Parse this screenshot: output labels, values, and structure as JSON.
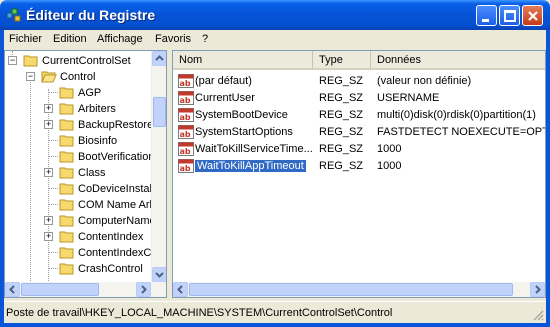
{
  "window": {
    "title": "Éditeur du Registre",
    "title_color": "#ffffff",
    "titlebar_color": "#0653d6"
  },
  "menu": {
    "items": [
      {
        "label": "Fichier"
      },
      {
        "label": "Edition"
      },
      {
        "label": "Affichage"
      },
      {
        "label": "Favoris"
      },
      {
        "label": "?"
      }
    ]
  },
  "tree": {
    "root": {
      "label": "CurrentControlSet"
    },
    "control": {
      "label": "Control"
    },
    "children": [
      {
        "label": "AGP",
        "expandable": false
      },
      {
        "label": "Arbiters",
        "expandable": true
      },
      {
        "label": "BackupRestore",
        "expandable": true
      },
      {
        "label": "Biosinfo",
        "expandable": false
      },
      {
        "label": "BootVerificationProgram",
        "expandable": false
      },
      {
        "label": "Class",
        "expandable": true
      },
      {
        "label": "CoDeviceInstallers",
        "expandable": false
      },
      {
        "label": "COM Name Arbiter",
        "expandable": false
      },
      {
        "label": "ComputerName",
        "expandable": true
      },
      {
        "label": "ContentIndex",
        "expandable": true
      },
      {
        "label": "ContentIndexCommon",
        "expandable": false
      },
      {
        "label": "CrashControl",
        "expandable": false
      }
    ]
  },
  "list": {
    "headers": {
      "name": "Nom",
      "type": "Type",
      "data": "Données"
    },
    "rows": [
      {
        "name": "(par défaut)",
        "type": "REG_SZ",
        "data": "(valeur non définie)",
        "selected": false
      },
      {
        "name": "CurrentUser",
        "type": "REG_SZ",
        "data": "USERNAME",
        "selected": false
      },
      {
        "name": "SystemBootDevice",
        "type": "REG_SZ",
        "data": "multi(0)disk(0)rdisk(0)partition(1)",
        "selected": false
      },
      {
        "name": "SystemStartOptions",
        "type": "REG_SZ",
        "data": "FASTDETECT  NOEXECUTE=OPTIN",
        "selected": false
      },
      {
        "name": "WaitToKillServiceTime...",
        "type": "REG_SZ",
        "data": "1000",
        "selected": false
      },
      {
        "name": "WaitToKillAppTimeout",
        "type": "REG_SZ",
        "data": "1000",
        "selected": true
      }
    ]
  },
  "status": {
    "path": "Poste de travail\\HKEY_LOCAL_MACHINE\\SYSTEM\\CurrentControlSet\\Control"
  },
  "icons": {
    "app": "registry-editor-icon",
    "folder": "folder-icon",
    "folder_open": "folder-open-icon",
    "string_value": "string-value-icon",
    "minimize": "minimize-icon",
    "maximize": "maximize-icon",
    "close": "close-icon"
  }
}
